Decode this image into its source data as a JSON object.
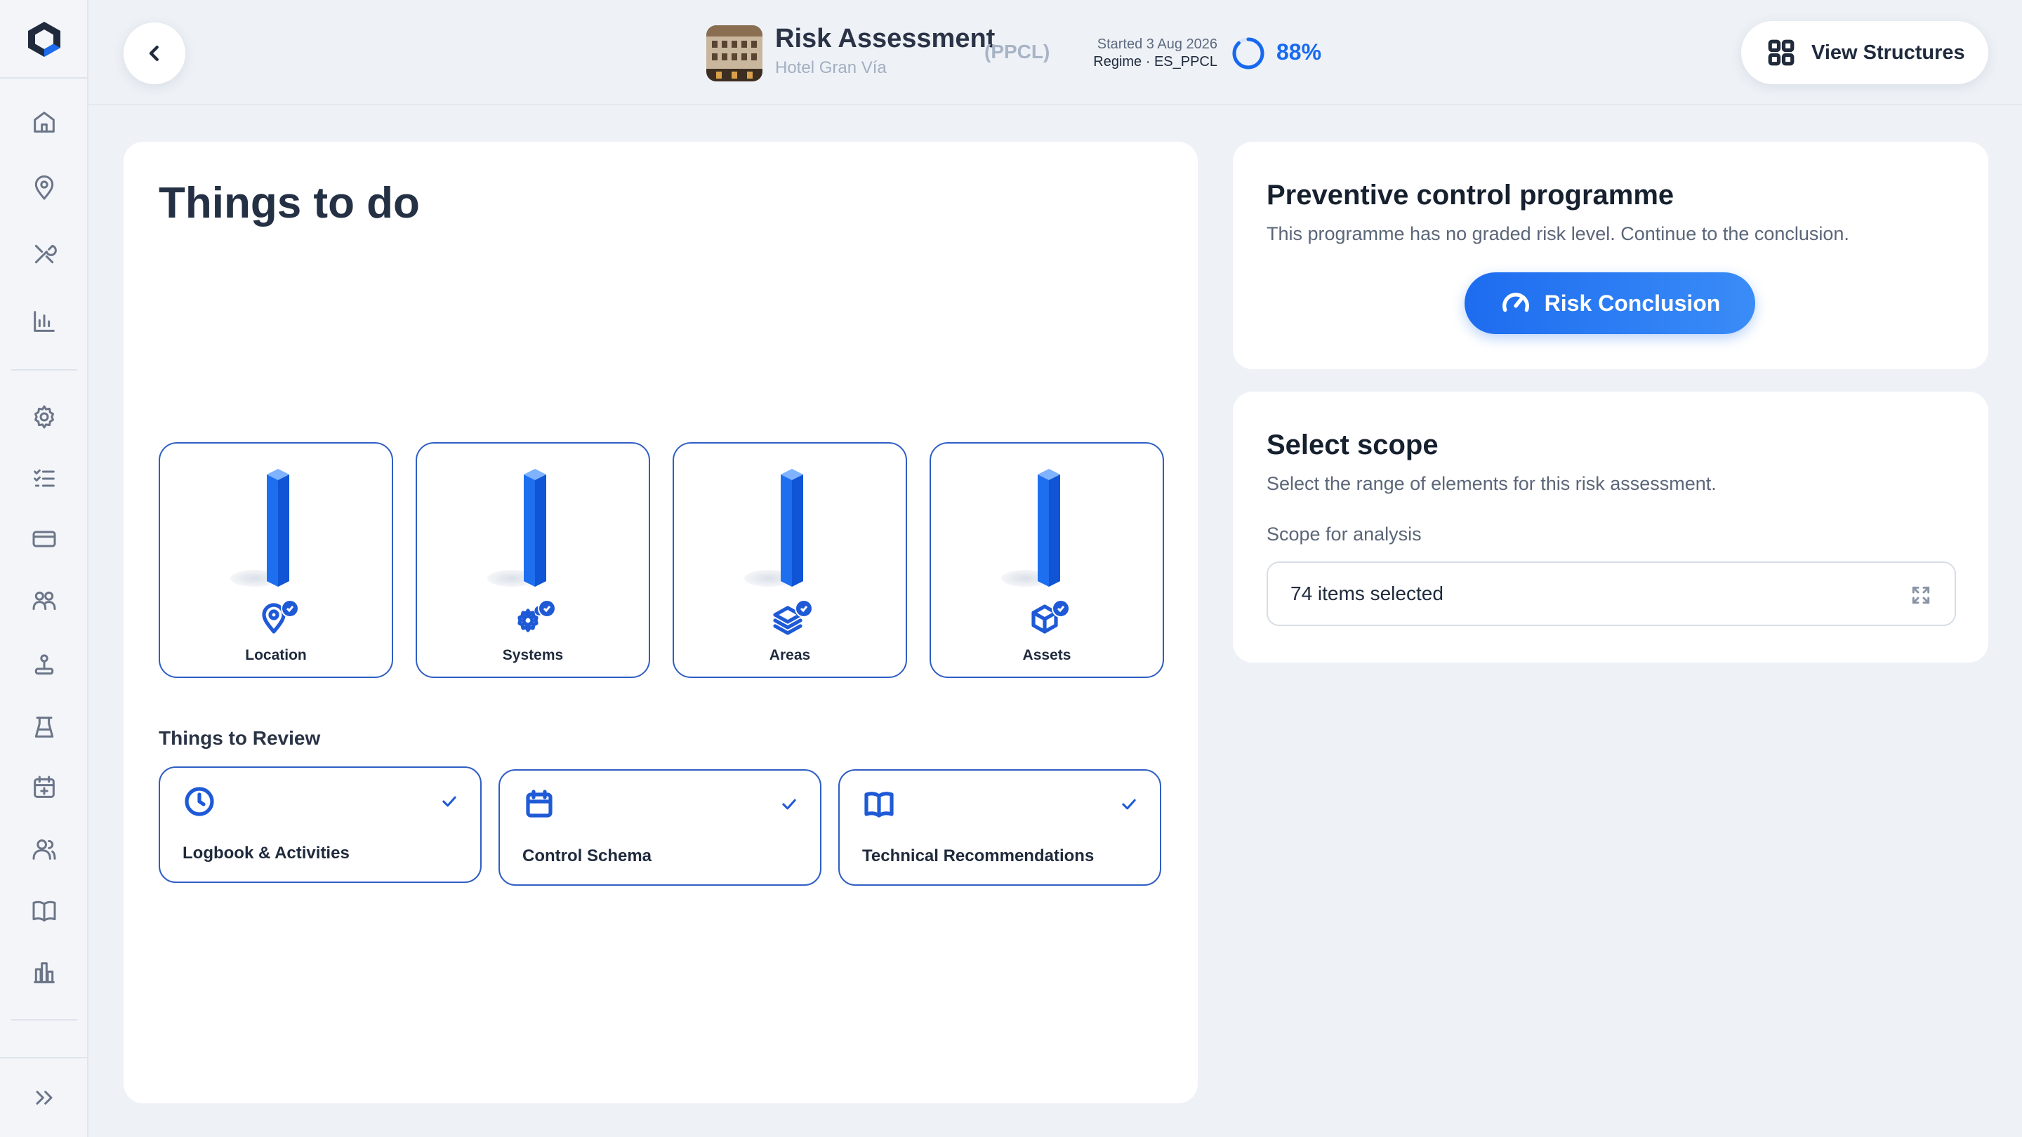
{
  "header": {
    "title": "Risk Assessment",
    "code": "(PPCL)",
    "subtitle": "Hotel Gran Vía",
    "started": "Started 3 Aug 2026",
    "regime": "Regime · ES_PPCL",
    "progress_percent": 88,
    "progress_label": "88%",
    "view_structures_label": "View Structures"
  },
  "sidebar": {
    "items": [
      "home-icon",
      "location-pin-icon",
      "tools-icon",
      "bar-chart-icon",
      "settings-icon",
      "checklist-icon",
      "card-icon",
      "group-icon",
      "joystick-icon",
      "lab-flask-icon",
      "calendar-plus-icon",
      "users-icon",
      "book-icon",
      "buildings-icon"
    ],
    "expand_icon": "double-chevron-right-icon"
  },
  "todo": {
    "title": "Things to do",
    "tiles": [
      {
        "label": "Location",
        "icon": "location-pin-icon",
        "done": true
      },
      {
        "label": "Systems",
        "icon": "gears-icon",
        "done": true
      },
      {
        "label": "Areas",
        "icon": "layers-icon",
        "done": true
      },
      {
        "label": "Assets",
        "icon": "cube-icon",
        "done": true
      }
    ],
    "review_heading": "Things to Review",
    "review_items": [
      {
        "label": "Logbook & Activities",
        "icon": "clock-icon",
        "done": true
      },
      {
        "label": "Control Schema",
        "icon": "calendar-icon",
        "done": true
      },
      {
        "label": "Technical Recommendations",
        "icon": "open-book-icon",
        "done": true
      }
    ]
  },
  "preventive": {
    "title": "Preventive control programme",
    "description": "This programme has no graded risk level. Continue to the conclusion.",
    "button_label": "Risk Conclusion"
  },
  "scope": {
    "title": "Select scope",
    "description": "Select the range of elements for this risk assessment.",
    "field_label": "Scope for analysis",
    "selected_value": "74 items selected"
  },
  "colors": {
    "accent": "#1d6cf0",
    "tile_border": "#2f5ec4",
    "background": "#eef2f7"
  }
}
